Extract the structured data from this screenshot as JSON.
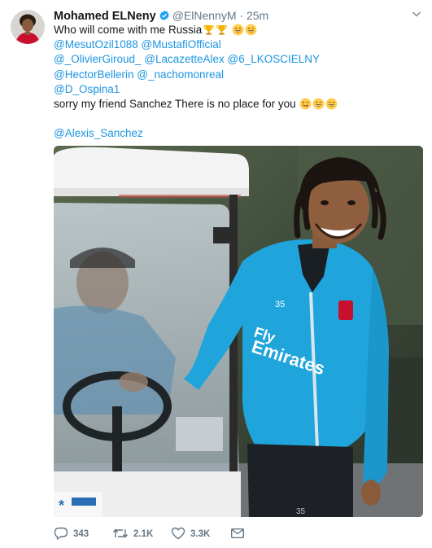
{
  "tweet": {
    "author_name": "Mohamed ELNeny",
    "author_handle": "@ElNennyM",
    "separator": "·",
    "time": "25m",
    "text_line1": "Who will come with me Russia",
    "mentions_line2": [
      "@MesutOzil1088",
      "@MustafiOfficial"
    ],
    "mentions_line3": [
      "@_OlivierGiroud_",
      "@LacazetteAlex",
      "@6_LKOSCIELNY"
    ],
    "mentions_line4": [
      "@HectorBellerin",
      "@_nachomonreal"
    ],
    "mentions_line5": [
      "@D_Ospina1"
    ],
    "text_line6": "sorry my friend Sanchez There is no place for you",
    "mention_last": "@Alexis_Sanchez"
  },
  "media": {
    "jersey_sponsor_1": "Fly",
    "jersey_sponsor_2": "Emirates",
    "jersey_number": "35"
  },
  "actions": {
    "replies": "343",
    "retweets": "2.1K",
    "likes": "3.3K"
  },
  "colors": {
    "link": "#1b95e0",
    "secondary_text": "#657786",
    "verified": "#1da1f2"
  },
  "icons": {
    "verified": "verified-badge-icon",
    "reply": "reply-icon",
    "retweet": "retweet-icon",
    "like": "heart-icon",
    "dm": "envelope-icon",
    "caret": "chevron-down-icon"
  }
}
